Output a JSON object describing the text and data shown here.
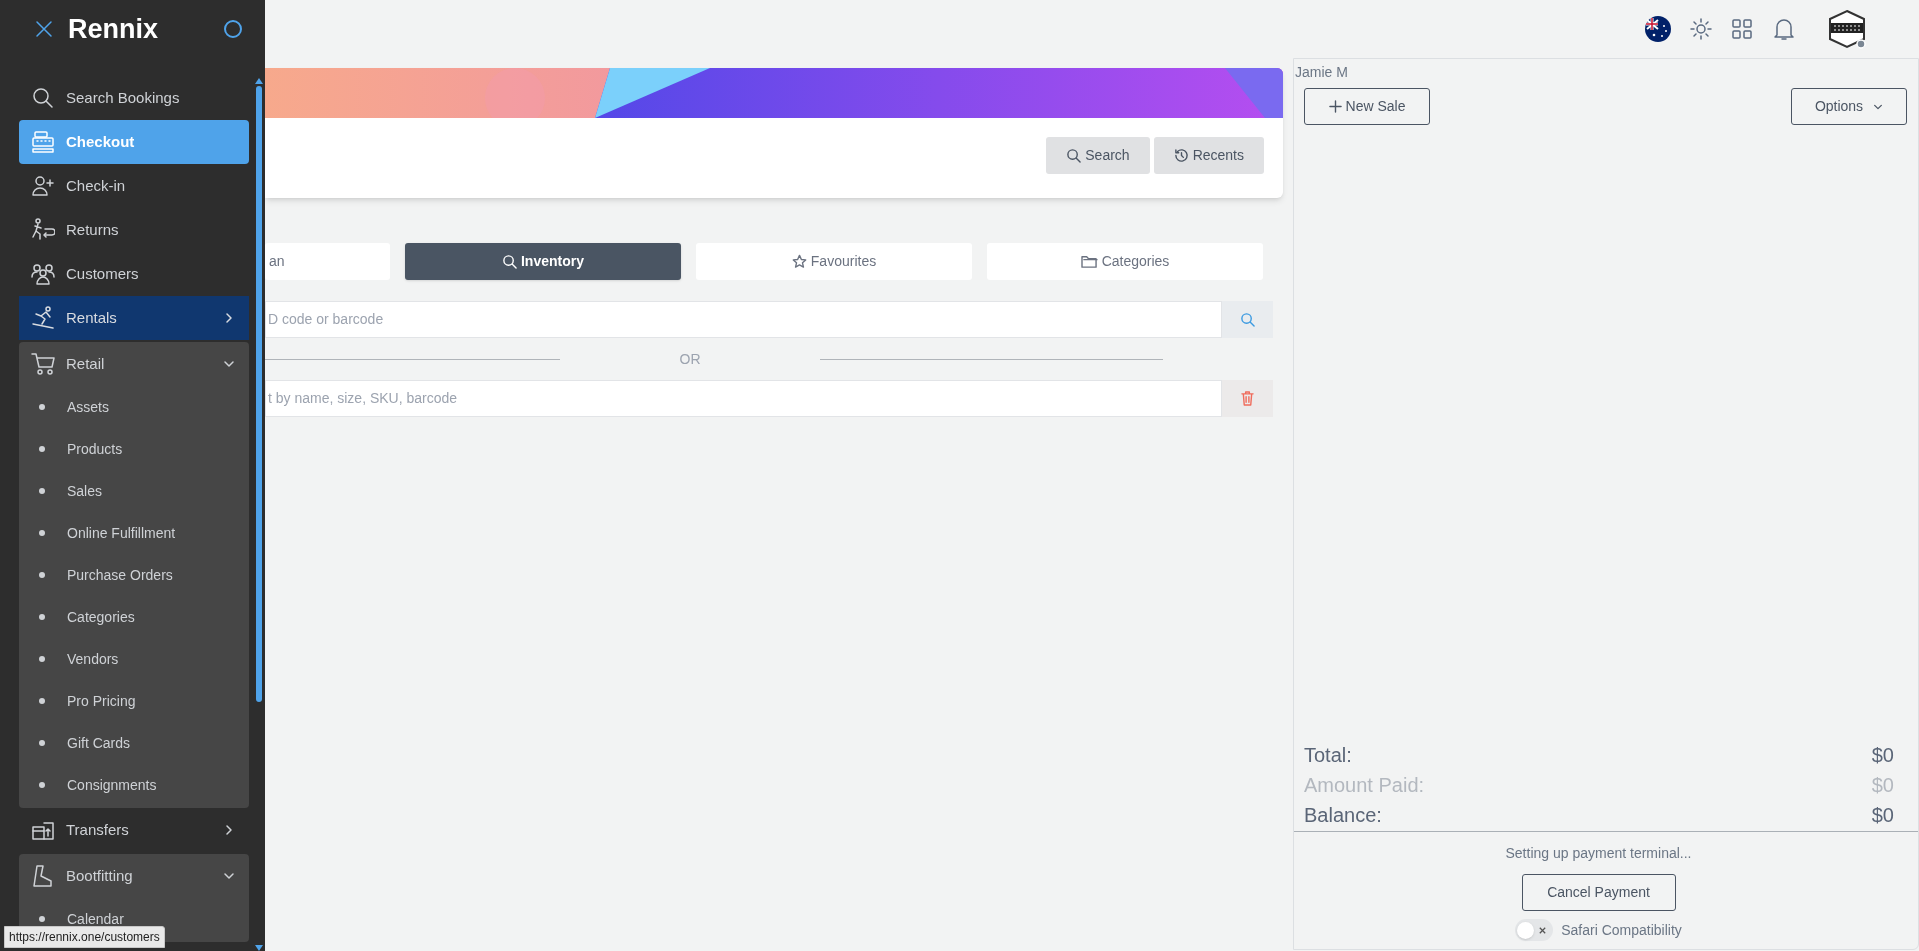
{
  "sidebar": {
    "brand": "Rennix",
    "items": [
      {
        "label": "Search Bookings",
        "kind": "link",
        "selected": false
      },
      {
        "label": "Checkout",
        "kind": "link",
        "selected": true
      },
      {
        "label": "Check-in",
        "kind": "link",
        "selected": false
      },
      {
        "label": "Returns",
        "kind": "link",
        "selected": false
      },
      {
        "label": "Customers",
        "kind": "link",
        "selected": false
      },
      {
        "label": "Rentals",
        "kind": "group",
        "selected": false,
        "hovered": true,
        "expanded": false
      },
      {
        "label": "Retail",
        "kind": "group",
        "selected": false,
        "expanded": true,
        "children": [
          {
            "label": "Assets"
          },
          {
            "label": "Products"
          },
          {
            "label": "Sales"
          },
          {
            "label": "Online Fulfillment"
          },
          {
            "label": "Purchase Orders"
          },
          {
            "label": "Categories"
          },
          {
            "label": "Vendors"
          },
          {
            "label": "Pro Pricing"
          },
          {
            "label": "Gift Cards"
          },
          {
            "label": "Consignments"
          }
        ]
      },
      {
        "label": "Transfers",
        "kind": "group",
        "selected": false,
        "expanded": false
      },
      {
        "label": "Bootfitting",
        "kind": "group",
        "selected": false,
        "expanded": true,
        "children": [
          {
            "label": "Calendar"
          }
        ]
      }
    ]
  },
  "status_tooltip": "https://rennix.one/customers",
  "header_buttons": [
    "Search",
    "Recents"
  ],
  "tabs": [
    {
      "label": "an",
      "selected": false
    },
    {
      "label": "Inventory",
      "selected": true
    },
    {
      "label": "Favourites",
      "selected": false
    },
    {
      "label": "Categories",
      "selected": false
    }
  ],
  "scan_field": {
    "placeholder": "D code or barcode"
  },
  "divider_text": "OR",
  "product_search": {
    "placeholder": "t by name, size, SKU, barcode"
  },
  "sale": {
    "user": "Jamie M",
    "new_sale": "New Sale",
    "options": "Options",
    "totals": [
      {
        "label": "Total:",
        "value": "$0",
        "muted": false
      },
      {
        "label": "Amount Paid:",
        "value": "$0",
        "muted": true
      },
      {
        "label": "Balance:",
        "value": "$0",
        "muted": false
      }
    ],
    "payment_status": "Setting up payment terminal...",
    "cancel": "Cancel Payment",
    "toggle": {
      "label": "Safari Compatibility",
      "on": false
    }
  }
}
